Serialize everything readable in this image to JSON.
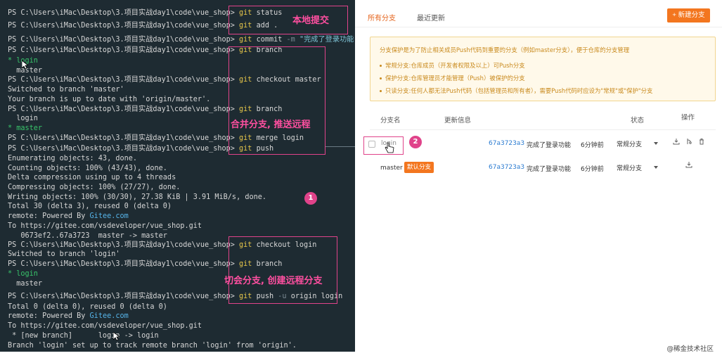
{
  "terminal": {
    "prompt": "PS C:\\Users\\iMac\\Desktop\\3.项目实战day1\\code\\vue_shop>",
    "cmd_git": "git",
    "cmd_status": "status",
    "cmd_add": "add .",
    "cmd_commit": "commit",
    "flag_m": "-m",
    "commit_msg": "\"完成了登录功能\"",
    "cmd_branch": "branch",
    "branch_login_star": "* login",
    "branch_master": "  master",
    "cmd_checkout_master": "checkout master",
    "switched_master": "Switched to branch 'master'",
    "up_to_date": "Your branch is up to date with 'origin/master'.",
    "branch_login": "  login",
    "branch_master_star": "* master",
    "cmd_merge_login": "merge login",
    "cmd_push": "push",
    "enumerating": "Enumerating objects: 43, done.",
    "counting": "Counting objects: 100% (43/43), done.",
    "delta": "Delta compression using up to 4 threads",
    "compressing": "Compressing objects: 100% (27/27), done.",
    "writing": "Writing objects: 100% (30/30), 27.38 KiB | 3.91 MiB/s, done.",
    "total1": "Total 30 (delta 3), reused 0 (delta 0)",
    "remote_powered": "remote: Powered By ",
    "gitee": "Gitee.com",
    "to_url": "To https://gitee.com/vsdeveloper/vue_shop.git",
    "range_line": "   0673ef2..67a3723  master -> master",
    "cmd_checkout_login": "checkout login",
    "switched_login": "Switched to branch 'login'",
    "branch_master2": "  master",
    "cmd_push_u": "push",
    "flag_u": "-u",
    "origin_login": "origin login",
    "total2": "Total 0 (delta 0), reused 0 (delta 0)",
    "new_branch": " * [new branch]      login -> login",
    "tracking": "Branch 'login' set up to track remote branch 'login' from 'origin'."
  },
  "annotations": {
    "local_commit": "本地提交",
    "merge_push": "合并分支, 推送远程",
    "switch_create": "切会分支, 创建远程分支",
    "badge1": "1",
    "badge2": "2"
  },
  "panel": {
    "tab_all": "所有分支",
    "tab_recent": "最近更新",
    "new_branch_btn": "+ 新建分支",
    "notice_title": "分支保护是为了防止相关成员Push代码到重要的分支（例如master分支），便于仓库的分支管理",
    "notice_items": [
      "常规分支:仓库成员（开发者权限及以上）可Push分支",
      "保护分支:仓库管理员才能管理（Push）被保护的分支",
      "只读分支:任何人都无法Push代码（包括管理员和所有者），需要Push代码时应设为\"常规\"或\"保护\"分支"
    ],
    "col_name": "分支名",
    "col_update": "更新信息",
    "col_status": "状态",
    "col_ops": "操作",
    "rows": [
      {
        "name": "login",
        "hash": "67a3723a3",
        "msg": "完成了登录功能",
        "time": "6分钟前",
        "status": "常规分支"
      },
      {
        "name": "master",
        "tag": "默认分支",
        "hash": "67a3723a3",
        "msg": "完成了登录功能",
        "time": "6分钟前",
        "status": "常规分支"
      }
    ],
    "watermark": "@稀金技术社区"
  },
  "colors": {
    "terminal_bg": "#1e2b32",
    "command": "#e6c64a",
    "annotation": "#e0438a",
    "accent": "#f3761f"
  }
}
